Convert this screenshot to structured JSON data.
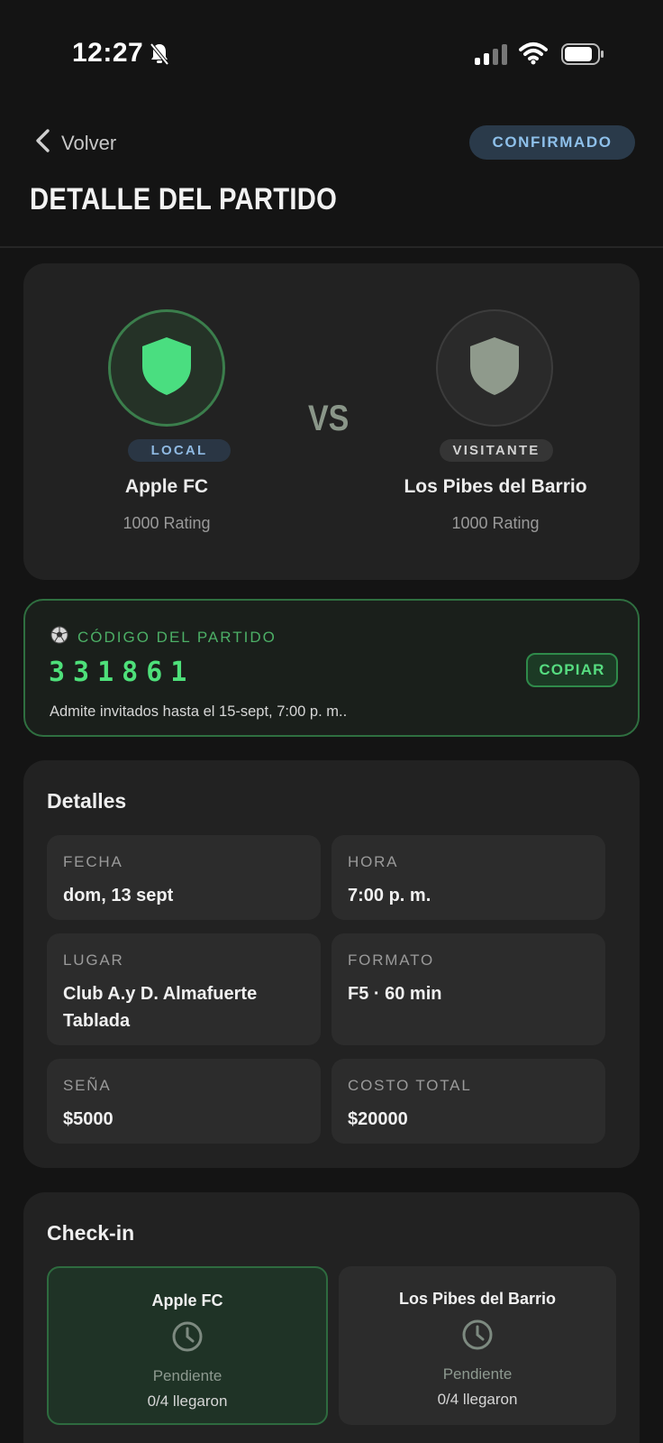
{
  "status_bar": {
    "time": "12:27",
    "icons": [
      "bell-slash-icon",
      "signal-icon",
      "wifi-icon",
      "battery-icon"
    ]
  },
  "header": {
    "back_label": "Volver",
    "status_badge": "CONFIRMADO",
    "title": "DETALLE DEL PARTIDO"
  },
  "match": {
    "vs_label": "VS",
    "home": {
      "role": "LOCAL",
      "name": "Apple FC",
      "rating": "1000 Rating",
      "crest_color": "#4ade80"
    },
    "away": {
      "role": "VISITANTE",
      "name": "Los Pibes del Barrio",
      "rating": "1000 Rating",
      "crest_color": "#8f9a8c"
    }
  },
  "code": {
    "label": "CÓDIGO DEL PARTIDO",
    "icon": "soccer-ball-icon",
    "value": "331861",
    "copy_label": "COPIAR",
    "note": "Admite invitados hasta el 15-sept, 7:00 p. m.."
  },
  "details": {
    "title": "Detalles",
    "fields": [
      {
        "label": "FECHA",
        "value": "dom, 13 sept"
      },
      {
        "label": "HORA",
        "value": "7:00 p. m."
      },
      {
        "label": "LUGAR",
        "value": "Club A.y D. Almafuerte Tablada"
      },
      {
        "label": "FORMATO",
        "value": "F5 · 60 min"
      },
      {
        "label": "SEÑA",
        "value": "$5000"
      },
      {
        "label": "COSTO TOTAL",
        "value": "$20000"
      }
    ]
  },
  "checkin": {
    "title": "Check-in",
    "teams": [
      {
        "name": "Apple FC",
        "status": "Pendiente",
        "count": "0/4 llegaron"
      },
      {
        "name": "Los Pibes del Barrio",
        "status": "Pendiente",
        "count": "0/4 llegaron"
      }
    ]
  },
  "colors": {
    "accent_green": "#4ee07a",
    "confirmed_blue": "#8ec0ea",
    "background": "#141414"
  }
}
